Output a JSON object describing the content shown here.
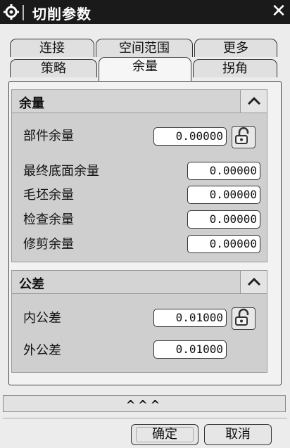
{
  "window": {
    "title": "切削参数",
    "close_glyph": "✕"
  },
  "tabs": {
    "row1": [
      "连接",
      "空间范围",
      "更多"
    ],
    "row2": [
      "策略",
      "余量",
      "拐角"
    ],
    "active": "余量"
  },
  "sections": {
    "stock": {
      "title": "余量",
      "collapse_glyph": "︿",
      "rows": [
        {
          "label": "部件余量",
          "value": "0.00000",
          "lock_icon": "unlock-icon"
        },
        {
          "label": "最终底面余量",
          "value": "0.00000"
        },
        {
          "label": "毛坯余量",
          "value": "0.00000"
        },
        {
          "label": "检查余量",
          "value": "0.00000"
        },
        {
          "label": "修剪余量",
          "value": "0.00000"
        }
      ]
    },
    "tolerance": {
      "title": "公差",
      "collapse_glyph": "︿",
      "rows": [
        {
          "label": "内公差",
          "value": "0.01000",
          "lock_icon": "unlock-icon"
        },
        {
          "label": "外公差",
          "value": "0.01000"
        }
      ]
    }
  },
  "footer": {
    "expand_glyph": "^^^",
    "ok_label": "确定",
    "cancel_label": "取消"
  }
}
